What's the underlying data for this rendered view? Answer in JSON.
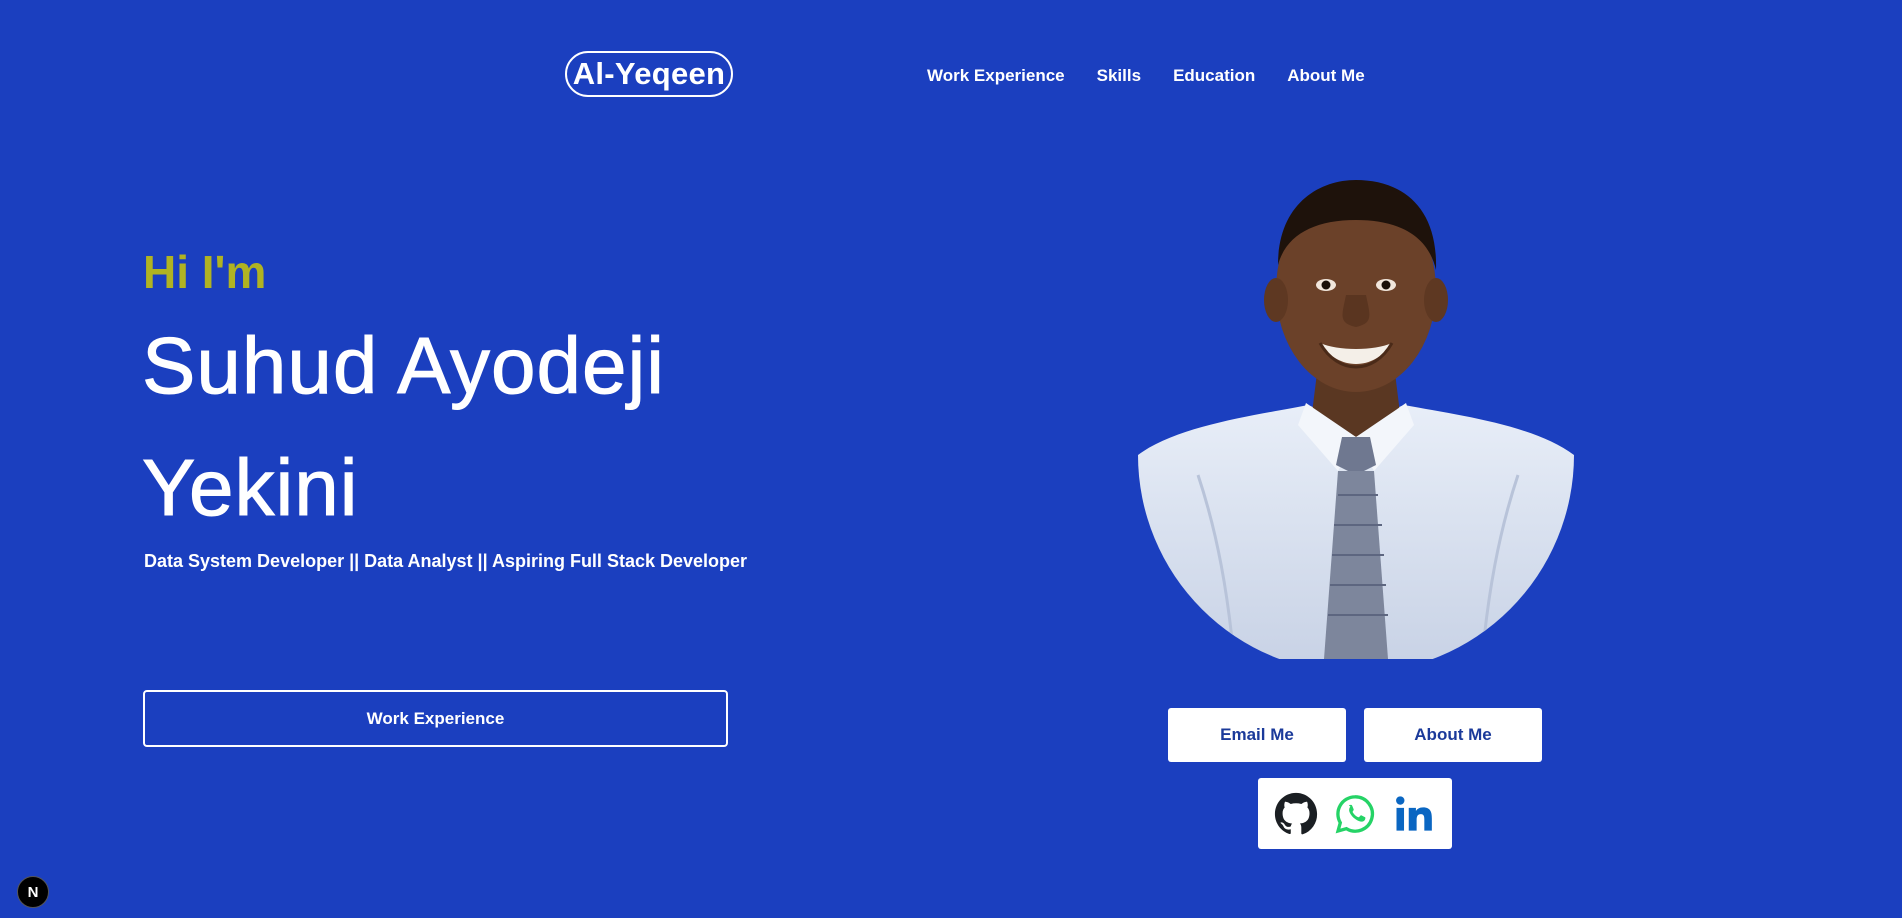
{
  "header": {
    "logo": "Al-Yeqeen",
    "nav": [
      {
        "label": "Work Experience"
      },
      {
        "label": "Skills"
      },
      {
        "label": "Education"
      },
      {
        "label": "About Me"
      }
    ]
  },
  "hero": {
    "greeting": "Hi I'm",
    "name_line1": "Suhud Ayodeji",
    "name_line2": "Yekini",
    "subtitle": "Data System Developer || Data Analyst || Aspiring Full Stack Developer",
    "cta_label": "Work Experience"
  },
  "profile": {
    "email_label": "Email Me",
    "about_label": "About Me",
    "socials": [
      {
        "icon": "github-icon"
      },
      {
        "icon": "whatsapp-icon"
      },
      {
        "icon": "linkedin-icon"
      }
    ]
  },
  "badge": {
    "letter": "N"
  },
  "colors": {
    "background": "#1b3fbf",
    "greeting": "#b0b322",
    "button_text": "#1b3a9a",
    "whatsapp": "#25d366",
    "linkedin": "#0a66c2"
  }
}
